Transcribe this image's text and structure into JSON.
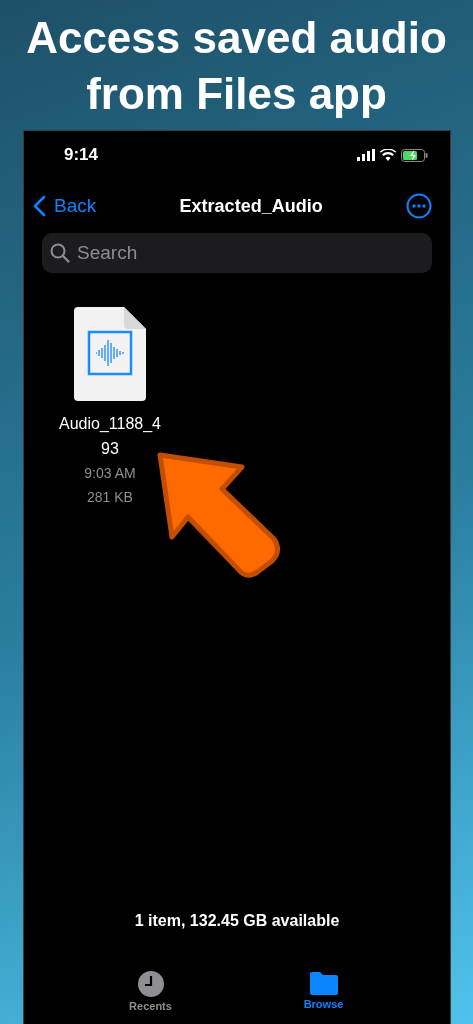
{
  "headline": [
    "Access saved audio",
    "from Files app"
  ],
  "status_bar": {
    "time": "9:14"
  },
  "nav": {
    "back": "Back",
    "title": "Extracted_Audio"
  },
  "search": {
    "placeholder": "Search"
  },
  "files": [
    {
      "name": "Audio_1188_493",
      "time": "9:03 AM",
      "size": "281 KB"
    }
  ],
  "footer": "1 item, 132.45 GB available",
  "tabs": [
    {
      "label": "Recents",
      "kind": "recents",
      "selected": false
    },
    {
      "label": "Browse",
      "kind": "browse",
      "selected": true
    }
  ]
}
